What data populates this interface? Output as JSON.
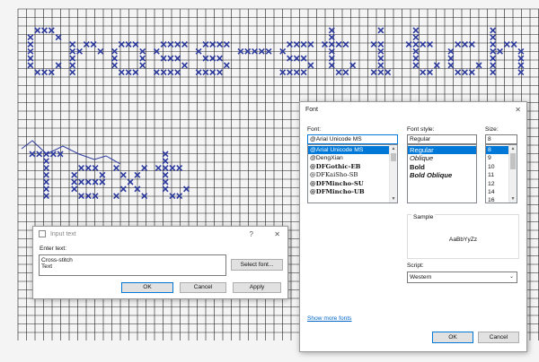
{
  "canvas": {
    "grid_color": "#1c1c1c",
    "background": "#f4f4f4",
    "stitch_color": "#2c3a9e",
    "line1": "Cross-stitch",
    "line2": "Text"
  },
  "input_dialog": {
    "title": "Input text",
    "help_glyph": "?",
    "close_glyph": "✕",
    "enter_label": "Enter text:",
    "text_line1": "Cross-stitch",
    "text_line2": "Text",
    "select_font_button": "Select font...",
    "ok_button": "OK",
    "cancel_button": "Cancel",
    "apply_button": "Apply"
  },
  "font_dialog": {
    "title": "Font",
    "close_glyph": "✕",
    "font_label": "Font:",
    "font_value": "@Arial Unicode MS",
    "fonts": [
      "@Arial Unicode MS",
      "@DengXian",
      "@DFGothic-EB",
      "@DFKaiSho-SB",
      "@DFMincho-SU",
      "@DFMincho-UB"
    ],
    "style_label": "Font style:",
    "style_value": "Regular",
    "styles": [
      "Regular",
      "Oblique",
      "Bold",
      "Bold Oblique"
    ],
    "size_label": "Size:",
    "size_value": "8",
    "sizes": [
      "8",
      "9",
      "10",
      "11",
      "12",
      "14",
      "16"
    ],
    "sample_label": "Sample",
    "sample_text": "AaBbYyZz",
    "script_label": "Script:",
    "script_value": "Western",
    "more_fonts_link": "Show more fonts",
    "ok_button": "OK",
    "cancel_button": "Cancel",
    "link_color": "#0066cc",
    "accent": "#0078d7"
  }
}
